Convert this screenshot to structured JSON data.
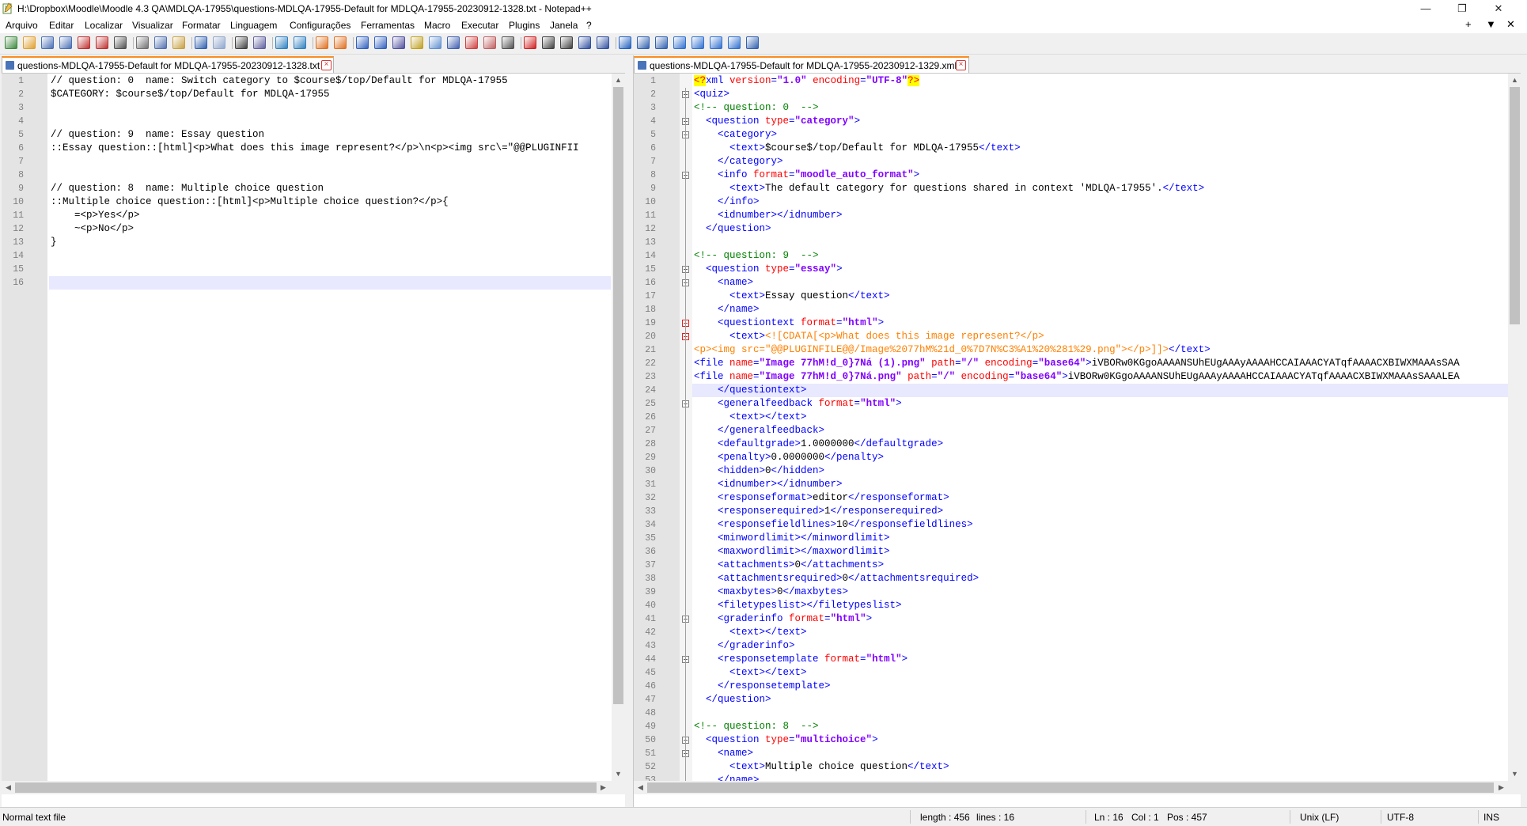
{
  "window": {
    "title": "H:\\Dropbox\\Moodle\\Moodle 4.3 QA\\MDLQA-17955\\questions-MDLQA-17955-Default for MDLQA-17955-20230912-1328.txt - Notepad++",
    "minimize": "—",
    "restore": "❐",
    "close": "✕",
    "menu_right": [
      "+",
      "▼",
      "✕"
    ]
  },
  "menu": [
    "Arquivo",
    "Editar",
    "Localizar",
    "Visualizar",
    "Formatar",
    "Linguagem",
    "Configurações",
    "Ferramentas",
    "Macro",
    "Executar",
    "Plugins",
    "Janela",
    "?"
  ],
  "toolbar_icons": [
    "new-file-icon",
    "open-file-icon",
    "save-icon",
    "save-all-icon",
    "close-icon",
    "close-all-icon",
    "print-icon",
    "cut-icon",
    "copy-icon",
    "paste-icon",
    "undo-icon",
    "redo-icon",
    "find-icon",
    "replace-icon",
    "zoom-in-icon",
    "zoom-out-icon",
    "sync-vertical-icon",
    "sync-horizontal-icon",
    "word-wrap-icon",
    "show-all-chars-icon",
    "indent-guide-icon",
    "udl-icon",
    "doc-map-icon",
    "function-list-icon",
    "folder-workspace-icon",
    "doc-switcher-icon",
    "monitoring-icon",
    "record-macro-icon",
    "stop-macro-icon",
    "play-macro-icon",
    "run-macro-multiple-icon",
    "save-macro-icon",
    "compare-icon",
    "compare-clear-icon",
    "navigation-icon",
    "first-diff-icon",
    "prev-diff-icon",
    "next-diff-icon",
    "last-diff-icon",
    "diff-bar-icon"
  ],
  "left": {
    "tab": "questions-MDLQA-17955-Default for MDLQA-17955-20230912-1328.txt",
    "current_line": 16,
    "lines": [
      "// question: 0  name: Switch category to $course$/top/Default for MDLQA-17955",
      "$CATEGORY: $course$/top/Default for MDLQA-17955",
      "",
      "",
      "// question: 9  name: Essay question",
      "::Essay question::[html]<p>What does this image represent?</p>\\n<p><img src\\=\"@@PLUGINFII",
      "",
      "",
      "// question: 8  name: Multiple choice question",
      "::Multiple choice question::[html]<p>Multiple choice question?</p>{",
      "    =<p>Yes</p>",
      "    ~<p>No</p>",
      "}",
      "",
      "",
      ""
    ]
  },
  "right": {
    "tab": "questions-MDLQA-17955-Default for MDLQA-17955-20230912-1329.xml",
    "current_line": 24,
    "lines": [
      [
        [
          "pi",
          "<?"
        ],
        [
          "tag",
          "xml "
        ],
        [
          "attr",
          "version"
        ],
        [
          "tag",
          "="
        ],
        [
          "val",
          "\"1.0\""
        ],
        [
          "tag",
          " "
        ],
        [
          "attr",
          "encoding"
        ],
        [
          "tag",
          "="
        ],
        [
          "val",
          "\"UTF-8\""
        ],
        [
          "pi",
          "?>"
        ]
      ],
      [
        [
          "tag",
          "<quiz>"
        ]
      ],
      [
        [
          "com",
          "<!-- question: 0  -->"
        ]
      ],
      [
        [
          "tag",
          "  <question "
        ],
        [
          "attr",
          "type"
        ],
        [
          "tag",
          "="
        ],
        [
          "val",
          "\"category\""
        ],
        [
          "tag",
          ">"
        ]
      ],
      [
        [
          "tag",
          "    <category>"
        ]
      ],
      [
        [
          "tag",
          "      <text>"
        ],
        [
          "txt",
          "$course$/top/Default for MDLQA-17955"
        ],
        [
          "tag",
          "</text>"
        ]
      ],
      [
        [
          "tag",
          "    </category>"
        ]
      ],
      [
        [
          "tag",
          "    <info "
        ],
        [
          "attr",
          "format"
        ],
        [
          "tag",
          "="
        ],
        [
          "val",
          "\"moodle_auto_format\""
        ],
        [
          "tag",
          ">"
        ]
      ],
      [
        [
          "tag",
          "      <text>"
        ],
        [
          "txt",
          "The default category for questions shared in context 'MDLQA-17955'."
        ],
        [
          "tag",
          "</text>"
        ]
      ],
      [
        [
          "tag",
          "    </info>"
        ]
      ],
      [
        [
          "tag",
          "    <idnumber></idnumber>"
        ]
      ],
      [
        [
          "tag",
          "  </question>"
        ]
      ],
      [],
      [
        [
          "com",
          "<!-- question: 9  -->"
        ]
      ],
      [
        [
          "tag",
          "  <question "
        ],
        [
          "attr",
          "type"
        ],
        [
          "tag",
          "="
        ],
        [
          "val",
          "\"essay\""
        ],
        [
          "tag",
          ">"
        ]
      ],
      [
        [
          "tag",
          "    <name>"
        ]
      ],
      [
        [
          "tag",
          "      <text>"
        ],
        [
          "txt",
          "Essay question"
        ],
        [
          "tag",
          "</text>"
        ]
      ],
      [
        [
          "tag",
          "    </name>"
        ]
      ],
      [
        [
          "tag",
          "    <questiontext "
        ],
        [
          "attr",
          "format"
        ],
        [
          "tag",
          "="
        ],
        [
          "val",
          "\"html\""
        ],
        [
          "tag",
          ">"
        ]
      ],
      [
        [
          "tag",
          "      <text>"
        ],
        [
          "cdata",
          "<![CDATA[<p>What does this image represent?</p>"
        ]
      ],
      [
        [
          "cdata",
          "<p><img src=\"@@PLUGINFILE@@/Image%2077hM%21d_0%7D7N%C3%A1%20%281%29.png\"></p>]]>"
        ],
        [
          "tag",
          "</text>"
        ]
      ],
      [
        [
          "tag",
          "<file "
        ],
        [
          "attr",
          "name"
        ],
        [
          "tag",
          "="
        ],
        [
          "val",
          "\"Image 77hM!d_0}7Ná (1).png\""
        ],
        [
          "tag",
          " "
        ],
        [
          "attr",
          "path"
        ],
        [
          "tag",
          "="
        ],
        [
          "val",
          "\"/\""
        ],
        [
          "tag",
          " "
        ],
        [
          "attr",
          "encoding"
        ],
        [
          "tag",
          "="
        ],
        [
          "val",
          "\"base64\""
        ],
        [
          "tag",
          ">"
        ],
        [
          "txt",
          "iVBORw0KGgoAAAANSUhEUgAAAyAAAAHCCAIAAACYATqfAAAACXBIWXMAAAsSAA"
        ]
      ],
      [
        [
          "tag",
          "<file "
        ],
        [
          "attr",
          "name"
        ],
        [
          "tag",
          "="
        ],
        [
          "val",
          "\"Image 77hM!d_0}7Ná.png\""
        ],
        [
          "tag",
          " "
        ],
        [
          "attr",
          "path"
        ],
        [
          "tag",
          "="
        ],
        [
          "val",
          "\"/\""
        ],
        [
          "tag",
          " "
        ],
        [
          "attr",
          "encoding"
        ],
        [
          "tag",
          "="
        ],
        [
          "val",
          "\"base64\""
        ],
        [
          "tag",
          ">"
        ],
        [
          "txt",
          "iVBORw0KGgoAAAANSUhEUgAAAyAAAAHCCAIAAACYATqfAAAACXBIWXMAAAsSAAALEA"
        ]
      ],
      [
        [
          "tag",
          "    </questiontext>"
        ]
      ],
      [
        [
          "tag",
          "    <generalfeedback "
        ],
        [
          "attr",
          "format"
        ],
        [
          "tag",
          "="
        ],
        [
          "val",
          "\"html\""
        ],
        [
          "tag",
          ">"
        ]
      ],
      [
        [
          "tag",
          "      <text></text>"
        ]
      ],
      [
        [
          "tag",
          "    </generalfeedback>"
        ]
      ],
      [
        [
          "tag",
          "    <defaultgrade>"
        ],
        [
          "txt",
          "1.0000000"
        ],
        [
          "tag",
          "</defaultgrade>"
        ]
      ],
      [
        [
          "tag",
          "    <penalty>"
        ],
        [
          "txt",
          "0.0000000"
        ],
        [
          "tag",
          "</penalty>"
        ]
      ],
      [
        [
          "tag",
          "    <hidden>"
        ],
        [
          "txt",
          "0"
        ],
        [
          "tag",
          "</hidden>"
        ]
      ],
      [
        [
          "tag",
          "    <idnumber></idnumber>"
        ]
      ],
      [
        [
          "tag",
          "    <responseformat>"
        ],
        [
          "txt",
          "editor"
        ],
        [
          "tag",
          "</responseformat>"
        ]
      ],
      [
        [
          "tag",
          "    <responserequired>"
        ],
        [
          "txt",
          "1"
        ],
        [
          "tag",
          "</responserequired>"
        ]
      ],
      [
        [
          "tag",
          "    <responsefieldlines>"
        ],
        [
          "txt",
          "10"
        ],
        [
          "tag",
          "</responsefieldlines>"
        ]
      ],
      [
        [
          "tag",
          "    <minwordlimit></minwordlimit>"
        ]
      ],
      [
        [
          "tag",
          "    <maxwordlimit></maxwordlimit>"
        ]
      ],
      [
        [
          "tag",
          "    <attachments>"
        ],
        [
          "txt",
          "0"
        ],
        [
          "tag",
          "</attachments>"
        ]
      ],
      [
        [
          "tag",
          "    <attachmentsrequired>"
        ],
        [
          "txt",
          "0"
        ],
        [
          "tag",
          "</attachmentsrequired>"
        ]
      ],
      [
        [
          "tag",
          "    <maxbytes>"
        ],
        [
          "txt",
          "0"
        ],
        [
          "tag",
          "</maxbytes>"
        ]
      ],
      [
        [
          "tag",
          "    <filetypeslist></filetypeslist>"
        ]
      ],
      [
        [
          "tag",
          "    <graderinfo "
        ],
        [
          "attr",
          "format"
        ],
        [
          "tag",
          "="
        ],
        [
          "val",
          "\"html\""
        ],
        [
          "tag",
          ">"
        ]
      ],
      [
        [
          "tag",
          "      <text></text>"
        ]
      ],
      [
        [
          "tag",
          "    </graderinfo>"
        ]
      ],
      [
        [
          "tag",
          "    <responsetemplate "
        ],
        [
          "attr",
          "format"
        ],
        [
          "tag",
          "="
        ],
        [
          "val",
          "\"html\""
        ],
        [
          "tag",
          ">"
        ]
      ],
      [
        [
          "tag",
          "      <text></text>"
        ]
      ],
      [
        [
          "tag",
          "    </responsetemplate>"
        ]
      ],
      [
        [
          "tag",
          "  </question>"
        ]
      ],
      [],
      [
        [
          "com",
          "<!-- question: 8  -->"
        ]
      ],
      [
        [
          "tag",
          "  <question "
        ],
        [
          "attr",
          "type"
        ],
        [
          "tag",
          "="
        ],
        [
          "val",
          "\"multichoice\""
        ],
        [
          "tag",
          ">"
        ]
      ],
      [
        [
          "tag",
          "    <name>"
        ]
      ],
      [
        [
          "tag",
          "      <text>"
        ],
        [
          "txt",
          "Multiple choice question"
        ],
        [
          "tag",
          "</text>"
        ]
      ],
      [
        [
          "tag",
          "    </name>"
        ]
      ]
    ]
  },
  "status": {
    "type": "Normal text file",
    "length": "length : 456",
    "lines": "lines : 16",
    "ln": "Ln : 16",
    "col": "Col : 1",
    "pos": "Pos : 457",
    "eol": "Unix (LF)",
    "encoding": "UTF-8",
    "mode": "INS"
  },
  "colors": {
    "tag": "#0000ff",
    "attr": "#ff0000",
    "value": "#8000ff",
    "comment": "#008000",
    "cdata": "#ff8000",
    "active_tab_accent": "#fa8c1e"
  }
}
